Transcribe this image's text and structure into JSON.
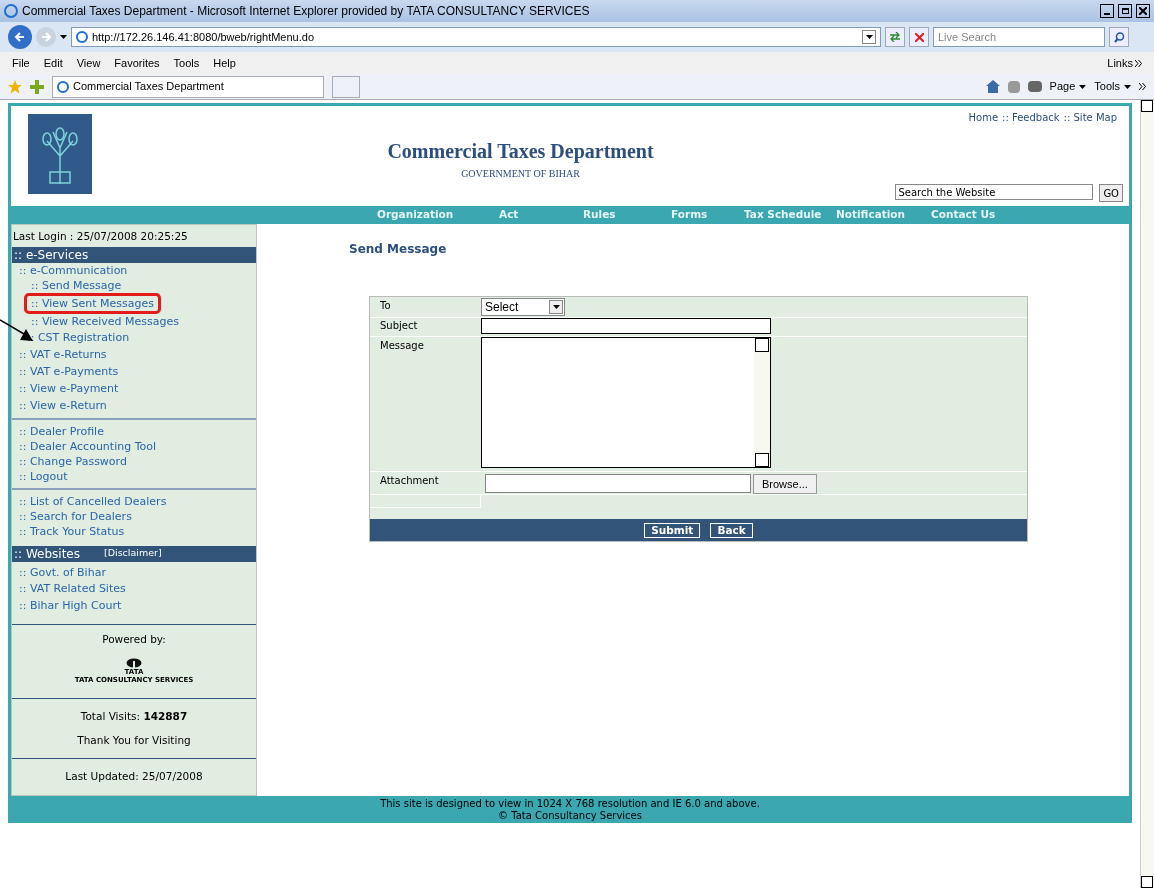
{
  "window": {
    "title": "Commercial Taxes Department - Microsoft Internet Explorer provided by TATA CONSULTANCY SERVICES"
  },
  "address_bar": {
    "url": "http://172.26.146.41:8080/bweb/rightMenu.do",
    "search_placeholder": "Live Search"
  },
  "menu_bar": {
    "items": [
      "File",
      "Edit",
      "View",
      "Favorites",
      "Tools",
      "Help"
    ],
    "links": "Links"
  },
  "tab": {
    "title": "Commercial Taxes Department"
  },
  "command_bar": {
    "items": [
      "Page",
      "Tools"
    ]
  },
  "header": {
    "title": "Commercial Taxes Department",
    "subtitle": "GOVERNMENT OF BIHAR",
    "top_links": [
      "Home",
      ":: Feedback",
      ":: Site Map"
    ],
    "search_value": "Search the Website",
    "go": "GO"
  },
  "nav": [
    "Organization",
    "Act",
    "Rules",
    "Forms",
    "Tax Schedule",
    "Notification",
    "Contact Us"
  ],
  "sidebar": {
    "last_login": "Last Login : 25/07/2008 20:25:25",
    "eservices": {
      "title": ":: e-Services",
      "items": [
        {
          "label": ":: e-Communication",
          "highlighted": false,
          "children": [
            {
              "label": ":: Send Message",
              "highlighted": false
            },
            {
              "label": ":: View Sent Messages",
              "highlighted": true
            },
            {
              "label": ":: View Received Messages",
              "highlighted": false
            }
          ]
        },
        {
          "label": ":: CST Registration",
          "highlighted": false
        },
        {
          "label": ":: VAT e-Returns",
          "highlighted": false
        },
        {
          "label": ":: VAT e-Payments",
          "highlighted": false
        },
        {
          "label": ":: View e-Payment",
          "highlighted": false
        },
        {
          "label": ":: View e-Return",
          "highlighted": false
        }
      ]
    },
    "groups": [
      [
        ":: Dealer Profile",
        ":: Dealer Accounting Tool",
        ":: Change Password",
        ":: Logout"
      ],
      [
        ":: List of Cancelled Dealers",
        ":: Search for Dealers",
        ":: Track Your Status"
      ]
    ],
    "websites": {
      "title": ":: Websites",
      "disclaimer": "[Disclaimer]",
      "items": [
        ":: Govt. of Bihar",
        ":: VAT Related Sites",
        ":: Bihar High Court"
      ]
    },
    "powered_by": "Powered by:",
    "logo_word": "TATA",
    "logo_caption": "TATA CONSULTANCY SERVICES",
    "visits": "Total Visits: **142887**",
    "thanks": "Thank You for Visiting",
    "last_updated": "Last Updated: 25/07/2008"
  },
  "form": {
    "heading": "Send Message",
    "to_label": "To",
    "to_value": "Select",
    "subject_label": "Subject",
    "message_label": "Message",
    "attachment_label": "Attachment",
    "browse": "Browse...",
    "buttons": [
      "Submit",
      "Back"
    ]
  },
  "footer": [
    "This site is designed to view in 1024 X 768 resolution and IE 6.0 and above.",
    "© Tata Consultancy Services"
  ]
}
